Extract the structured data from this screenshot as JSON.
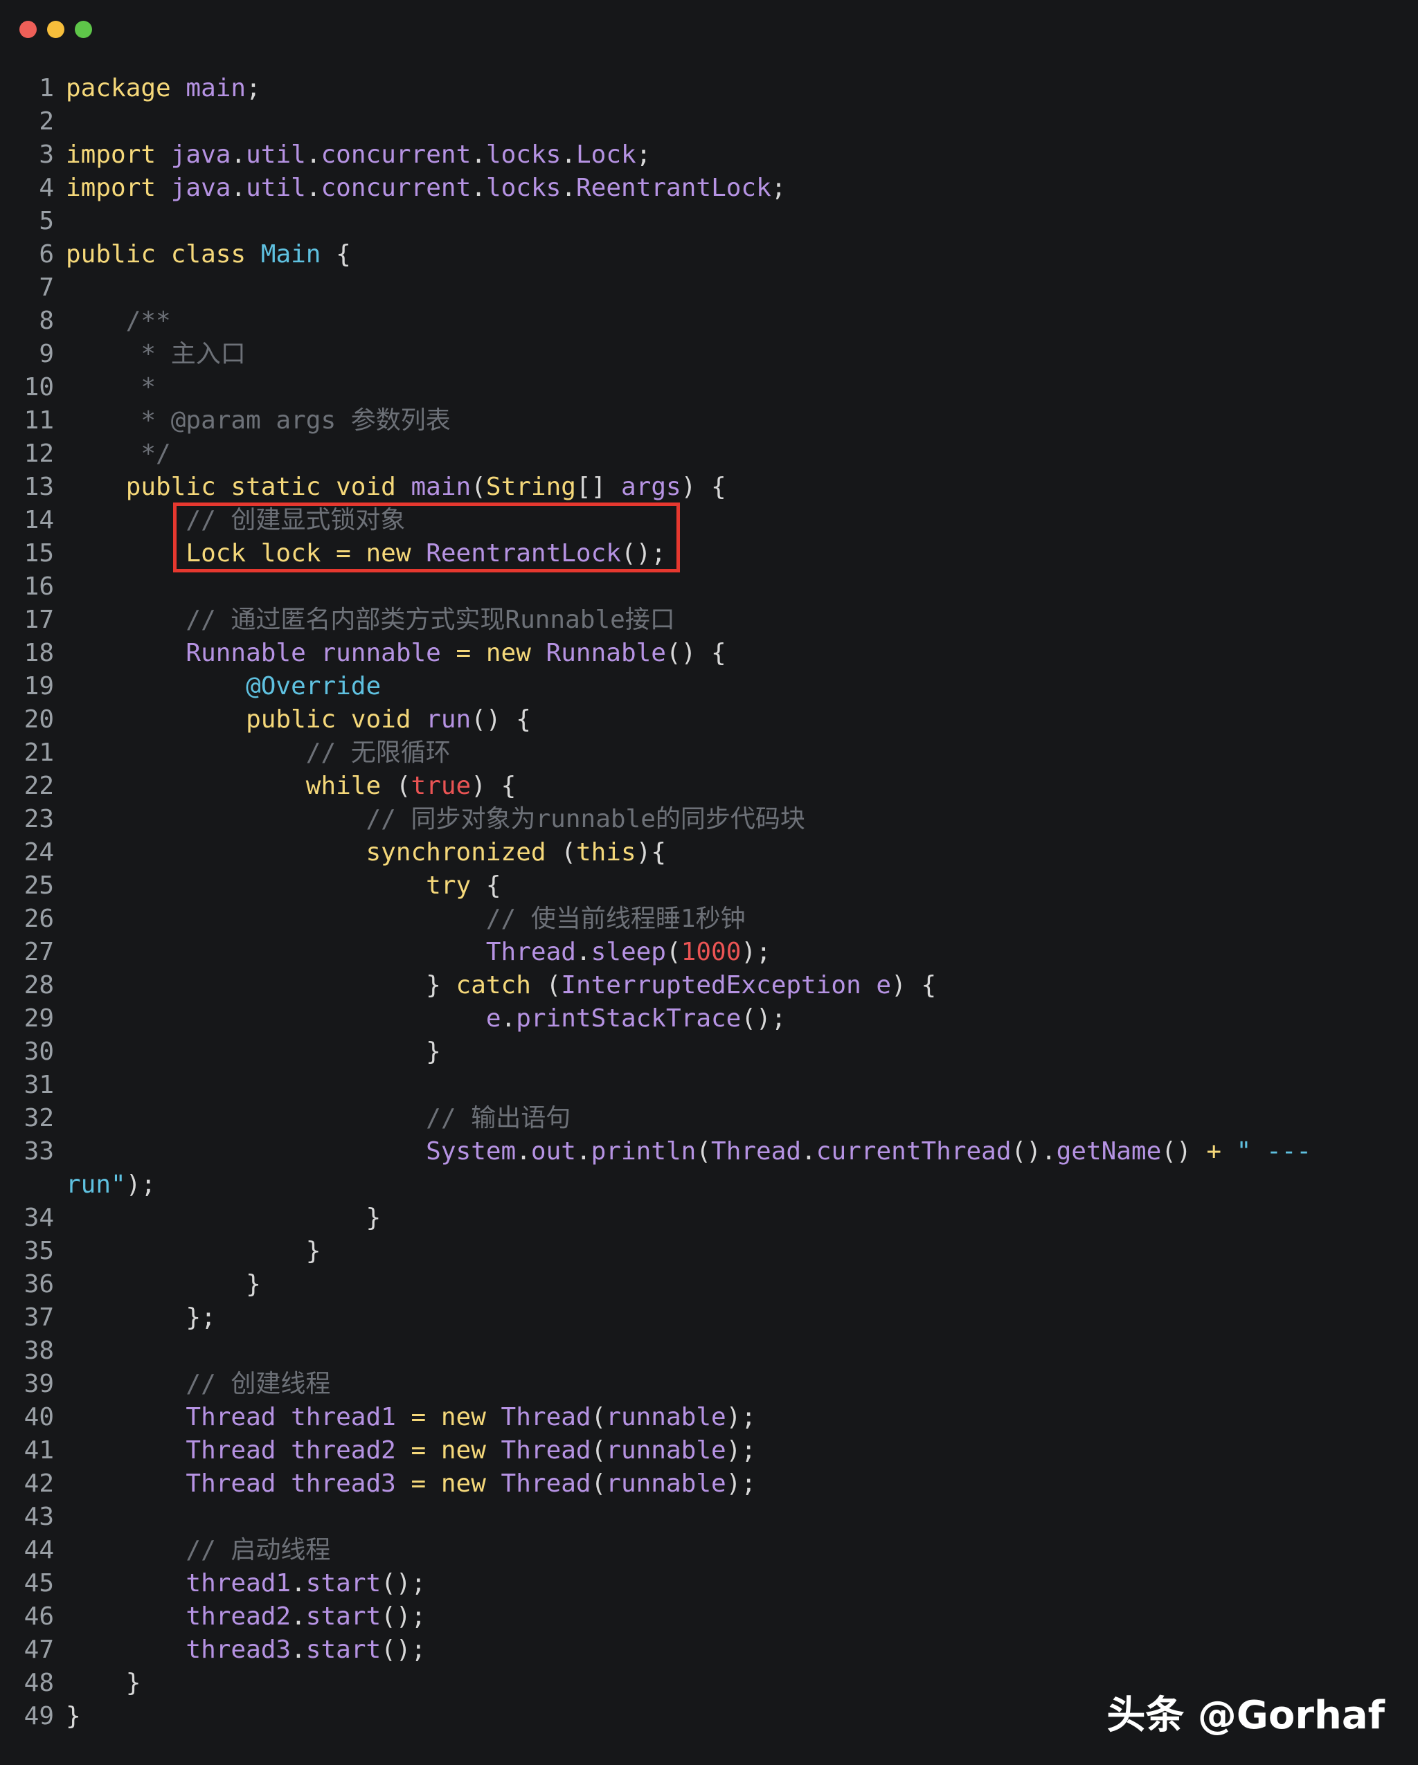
{
  "lines": [
    {
      "n": "1",
      "segs": [
        {
          "c": "kw",
          "t": "package "
        },
        {
          "c": "id",
          "t": "main"
        },
        {
          "c": "pl",
          "t": ";"
        }
      ]
    },
    {
      "n": "2",
      "segs": []
    },
    {
      "n": "3",
      "segs": [
        {
          "c": "kw",
          "t": "import "
        },
        {
          "c": "id",
          "t": "java"
        },
        {
          "c": "pl",
          "t": "."
        },
        {
          "c": "id",
          "t": "util"
        },
        {
          "c": "pl",
          "t": "."
        },
        {
          "c": "id",
          "t": "concurrent"
        },
        {
          "c": "pl",
          "t": "."
        },
        {
          "c": "id",
          "t": "locks"
        },
        {
          "c": "pl",
          "t": "."
        },
        {
          "c": "id",
          "t": "Lock"
        },
        {
          "c": "pl",
          "t": ";"
        }
      ]
    },
    {
      "n": "4",
      "segs": [
        {
          "c": "kw",
          "t": "import "
        },
        {
          "c": "id",
          "t": "java"
        },
        {
          "c": "pl",
          "t": "."
        },
        {
          "c": "id",
          "t": "util"
        },
        {
          "c": "pl",
          "t": "."
        },
        {
          "c": "id",
          "t": "concurrent"
        },
        {
          "c": "pl",
          "t": "."
        },
        {
          "c": "id",
          "t": "locks"
        },
        {
          "c": "pl",
          "t": "."
        },
        {
          "c": "id",
          "t": "ReentrantLock"
        },
        {
          "c": "pl",
          "t": ";"
        }
      ]
    },
    {
      "n": "5",
      "segs": []
    },
    {
      "n": "6",
      "segs": [
        {
          "c": "kw",
          "t": "public class "
        },
        {
          "c": "cls",
          "t": "Main"
        },
        {
          "c": "pl",
          "t": " {"
        }
      ]
    },
    {
      "n": "7",
      "segs": []
    },
    {
      "n": "8",
      "segs": [
        {
          "c": "cm",
          "t": "    /**"
        }
      ]
    },
    {
      "n": "9",
      "segs": [
        {
          "c": "cm",
          "t": "     * 主入口"
        }
      ]
    },
    {
      "n": "10",
      "segs": [
        {
          "c": "cm",
          "t": "     *"
        }
      ]
    },
    {
      "n": "11",
      "segs": [
        {
          "c": "cm",
          "t": "     * @param args 参数列表"
        }
      ]
    },
    {
      "n": "12",
      "segs": [
        {
          "c": "cm",
          "t": "     */"
        }
      ]
    },
    {
      "n": "13",
      "segs": [
        {
          "c": "kw",
          "t": "    public static void "
        },
        {
          "c": "id",
          "t": "main"
        },
        {
          "c": "pl",
          "t": "("
        },
        {
          "c": "kw",
          "t": "String"
        },
        {
          "c": "pl",
          "t": "[] "
        },
        {
          "c": "id",
          "t": "args"
        },
        {
          "c": "pl",
          "t": ") {"
        }
      ]
    },
    {
      "n": "14",
      "segs": [
        {
          "c": "cm",
          "t": "        // 创建显式锁对象"
        }
      ]
    },
    {
      "n": "15",
      "segs": [
        {
          "c": "kw",
          "t": "        Lock lock "
        },
        {
          "c": "kw",
          "t": "= new "
        },
        {
          "c": "id",
          "t": "ReentrantLock"
        },
        {
          "c": "pl",
          "t": "();"
        }
      ]
    },
    {
      "n": "16",
      "segs": []
    },
    {
      "n": "17",
      "segs": [
        {
          "c": "cm",
          "t": "        // 通过匿名内部类方式实现Runnable接口"
        }
      ]
    },
    {
      "n": "18",
      "segs": [
        {
          "c": "id",
          "t": "        Runnable runnable "
        },
        {
          "c": "kw",
          "t": "= new "
        },
        {
          "c": "id",
          "t": "Runnable"
        },
        {
          "c": "pl",
          "t": "() {"
        }
      ]
    },
    {
      "n": "19",
      "segs": [
        {
          "c": "an",
          "t": "            @Override"
        }
      ]
    },
    {
      "n": "20",
      "segs": [
        {
          "c": "kw",
          "t": "            public void "
        },
        {
          "c": "id",
          "t": "run"
        },
        {
          "c": "pl",
          "t": "() {"
        }
      ]
    },
    {
      "n": "21",
      "segs": [
        {
          "c": "cm",
          "t": "                // 无限循环"
        }
      ]
    },
    {
      "n": "22",
      "segs": [
        {
          "c": "kw",
          "t": "                while "
        },
        {
          "c": "pl",
          "t": "("
        },
        {
          "c": "bl",
          "t": "true"
        },
        {
          "c": "pl",
          "t": ") {"
        }
      ]
    },
    {
      "n": "23",
      "segs": [
        {
          "c": "cm",
          "t": "                    // 同步对象为runnable的同步代码块"
        }
      ]
    },
    {
      "n": "24",
      "segs": [
        {
          "c": "kw",
          "t": "                    synchronized "
        },
        {
          "c": "pl",
          "t": "("
        },
        {
          "c": "kw",
          "t": "this"
        },
        {
          "c": "pl",
          "t": "){"
        }
      ]
    },
    {
      "n": "25",
      "segs": [
        {
          "c": "kw",
          "t": "                        try "
        },
        {
          "c": "pl",
          "t": "{"
        }
      ]
    },
    {
      "n": "26",
      "segs": [
        {
          "c": "cm",
          "t": "                            // 使当前线程睡1秒钟"
        }
      ]
    },
    {
      "n": "27",
      "segs": [
        {
          "c": "id",
          "t": "                            Thread"
        },
        {
          "c": "pl",
          "t": "."
        },
        {
          "c": "id",
          "t": "sleep"
        },
        {
          "c": "pl",
          "t": "("
        },
        {
          "c": "bl",
          "t": "1000"
        },
        {
          "c": "pl",
          "t": ");"
        }
      ]
    },
    {
      "n": "28",
      "segs": [
        {
          "c": "pl",
          "t": "                        } "
        },
        {
          "c": "kw",
          "t": "catch "
        },
        {
          "c": "pl",
          "t": "("
        },
        {
          "c": "id",
          "t": "InterruptedException e"
        },
        {
          "c": "pl",
          "t": ") {"
        }
      ]
    },
    {
      "n": "29",
      "segs": [
        {
          "c": "id",
          "t": "                            e"
        },
        {
          "c": "pl",
          "t": "."
        },
        {
          "c": "id",
          "t": "printStackTrace"
        },
        {
          "c": "pl",
          "t": "();"
        }
      ]
    },
    {
      "n": "30",
      "segs": [
        {
          "c": "pl",
          "t": "                        }"
        }
      ]
    },
    {
      "n": "31",
      "segs": []
    },
    {
      "n": "32",
      "segs": [
        {
          "c": "cm",
          "t": "                        // 输出语句"
        }
      ]
    },
    {
      "n": "33",
      "segs": [
        {
          "c": "id",
          "t": "                        System"
        },
        {
          "c": "pl",
          "t": "."
        },
        {
          "c": "id",
          "t": "out"
        },
        {
          "c": "pl",
          "t": "."
        },
        {
          "c": "id",
          "t": "println"
        },
        {
          "c": "pl",
          "t": "("
        },
        {
          "c": "id",
          "t": "Thread"
        },
        {
          "c": "pl",
          "t": "."
        },
        {
          "c": "id",
          "t": "currentThread"
        },
        {
          "c": "pl",
          "t": "()."
        },
        {
          "c": "id",
          "t": "getName"
        },
        {
          "c": "pl",
          "t": "() "
        },
        {
          "c": "kw",
          "t": "+ "
        },
        {
          "c": "st",
          "t": "\" ---"
        }
      ],
      "wrap": [
        {
          "c": "st",
          "t": "run\""
        },
        {
          "c": "pl",
          "t": ");"
        }
      ]
    },
    {
      "n": "34",
      "segs": [
        {
          "c": "pl",
          "t": "                    }"
        }
      ]
    },
    {
      "n": "35",
      "segs": [
        {
          "c": "pl",
          "t": "                }"
        }
      ]
    },
    {
      "n": "36",
      "segs": [
        {
          "c": "pl",
          "t": "            }"
        }
      ]
    },
    {
      "n": "37",
      "segs": [
        {
          "c": "pl",
          "t": "        };"
        }
      ]
    },
    {
      "n": "38",
      "segs": []
    },
    {
      "n": "39",
      "segs": [
        {
          "c": "cm",
          "t": "        // 创建线程"
        }
      ]
    },
    {
      "n": "40",
      "segs": [
        {
          "c": "id",
          "t": "        Thread thread1 "
        },
        {
          "c": "kw",
          "t": "= new "
        },
        {
          "c": "id",
          "t": "Thread"
        },
        {
          "c": "pl",
          "t": "("
        },
        {
          "c": "id",
          "t": "runnable"
        },
        {
          "c": "pl",
          "t": ");"
        }
      ]
    },
    {
      "n": "41",
      "segs": [
        {
          "c": "id",
          "t": "        Thread thread2 "
        },
        {
          "c": "kw",
          "t": "= new "
        },
        {
          "c": "id",
          "t": "Thread"
        },
        {
          "c": "pl",
          "t": "("
        },
        {
          "c": "id",
          "t": "runnable"
        },
        {
          "c": "pl",
          "t": ");"
        }
      ]
    },
    {
      "n": "42",
      "segs": [
        {
          "c": "id",
          "t": "        Thread thread3 "
        },
        {
          "c": "kw",
          "t": "= new "
        },
        {
          "c": "id",
          "t": "Thread"
        },
        {
          "c": "pl",
          "t": "("
        },
        {
          "c": "id",
          "t": "runnable"
        },
        {
          "c": "pl",
          "t": ");"
        }
      ]
    },
    {
      "n": "43",
      "segs": []
    },
    {
      "n": "44",
      "segs": [
        {
          "c": "cm",
          "t": "        // 启动线程"
        }
      ]
    },
    {
      "n": "45",
      "segs": [
        {
          "c": "id",
          "t": "        thread1"
        },
        {
          "c": "pl",
          "t": "."
        },
        {
          "c": "id",
          "t": "start"
        },
        {
          "c": "pl",
          "t": "();"
        }
      ]
    },
    {
      "n": "46",
      "segs": [
        {
          "c": "id",
          "t": "        thread2"
        },
        {
          "c": "pl",
          "t": "."
        },
        {
          "c": "id",
          "t": "start"
        },
        {
          "c": "pl",
          "t": "();"
        }
      ]
    },
    {
      "n": "47",
      "segs": [
        {
          "c": "id",
          "t": "        thread3"
        },
        {
          "c": "pl",
          "t": "."
        },
        {
          "c": "id",
          "t": "start"
        },
        {
          "c": "pl",
          "t": "();"
        }
      ]
    },
    {
      "n": "48",
      "segs": [
        {
          "c": "pl",
          "t": "    }"
        }
      ]
    },
    {
      "n": "49",
      "segs": [
        {
          "c": "pl",
          "t": "}"
        }
      ]
    }
  ],
  "watermark": "头条 @Gorhaf"
}
